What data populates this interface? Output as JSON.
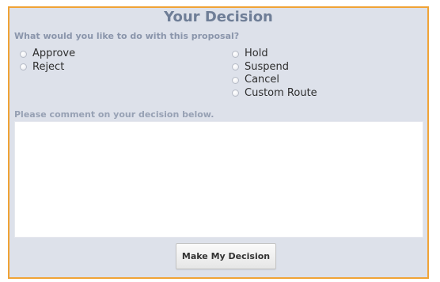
{
  "panel": {
    "title": "Your Decision",
    "border_color": "#f0a336",
    "background_color": "#dde1ea"
  },
  "decision": {
    "question": "What would you like to do with this proposal?",
    "left_options": [
      {
        "label": "Approve",
        "selected": false
      },
      {
        "label": "Reject",
        "selected": false
      }
    ],
    "right_options": [
      {
        "label": "Hold",
        "selected": false
      },
      {
        "label": "Suspend",
        "selected": false
      },
      {
        "label": "Cancel",
        "selected": false
      },
      {
        "label": "Custom Route",
        "selected": false
      }
    ]
  },
  "comment": {
    "label": "Please comment on your decision below.",
    "value": ""
  },
  "submit": {
    "label": "Make My Decision"
  }
}
